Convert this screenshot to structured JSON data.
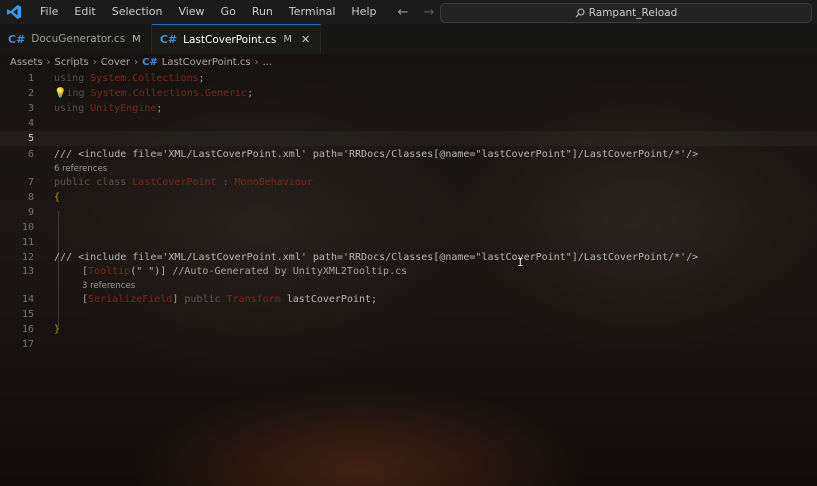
{
  "titlebar": {
    "menu": [
      "File",
      "Edit",
      "Selection",
      "View",
      "Go",
      "Run",
      "Terminal",
      "Help"
    ],
    "search_text": "Rampant_Reload"
  },
  "tabs": [
    {
      "label": "DocuGenerator.cs",
      "modified": "M"
    },
    {
      "label": "LastCoverPoint.cs",
      "modified": "M",
      "close": "✕"
    }
  ],
  "breadcrumb": [
    "Assets",
    "Scripts",
    "Cover",
    "LastCoverPoint.cs",
    "..."
  ],
  "editor": {
    "line_numbers": [
      "1",
      "2",
      "3",
      "4",
      "5",
      "6",
      "7",
      "8",
      "9",
      "10",
      "11",
      "12",
      "13",
      "14",
      "15",
      "16",
      "17"
    ],
    "line1": {
      "kw": "using",
      "rest": " ",
      "ns": "System.Collections",
      "semi": ";"
    },
    "line2": {
      "kw": "ing",
      "rest": " ",
      "ns": "System.Collections.Generic",
      "semi": ";"
    },
    "line3": {
      "kw": "using",
      "rest": " ",
      "ns": "UnityEngine",
      "semi": ";"
    },
    "line6": {
      "text": "/// <include file='XML/LastCoverPoint.xml' path='RRDocs/Classes[@name=\"lastCoverPoint\"]/LastCoverPoint/*'/>"
    },
    "lens7": "6 references",
    "line7": {
      "kw": "public class",
      "cls": "LastCoverPoint",
      "colon": " : ",
      "base": "MonoBehaviour"
    },
    "line8": {
      "brace": "{"
    },
    "line12": {
      "text": "/// <include file='XML/LastCoverPoint.xml' path='RRDocs/Classes[@name=\"lastCoverPoint\"]/LastCoverPoint/*'/>"
    },
    "line13": {
      "open": "[",
      "attr": "Tooltip",
      "args": "(\" \")]",
      "comment": " //Auto-Generated by UnityXML2Tooltip.cs"
    },
    "lens14": "3 references",
    "line14": {
      "open": "[",
      "attr": "SerializeField",
      "close": "]",
      "kw": " public ",
      "type": "Transform",
      "name": " lastCoverPoint;"
    },
    "line16": {
      "brace": "}"
    }
  }
}
